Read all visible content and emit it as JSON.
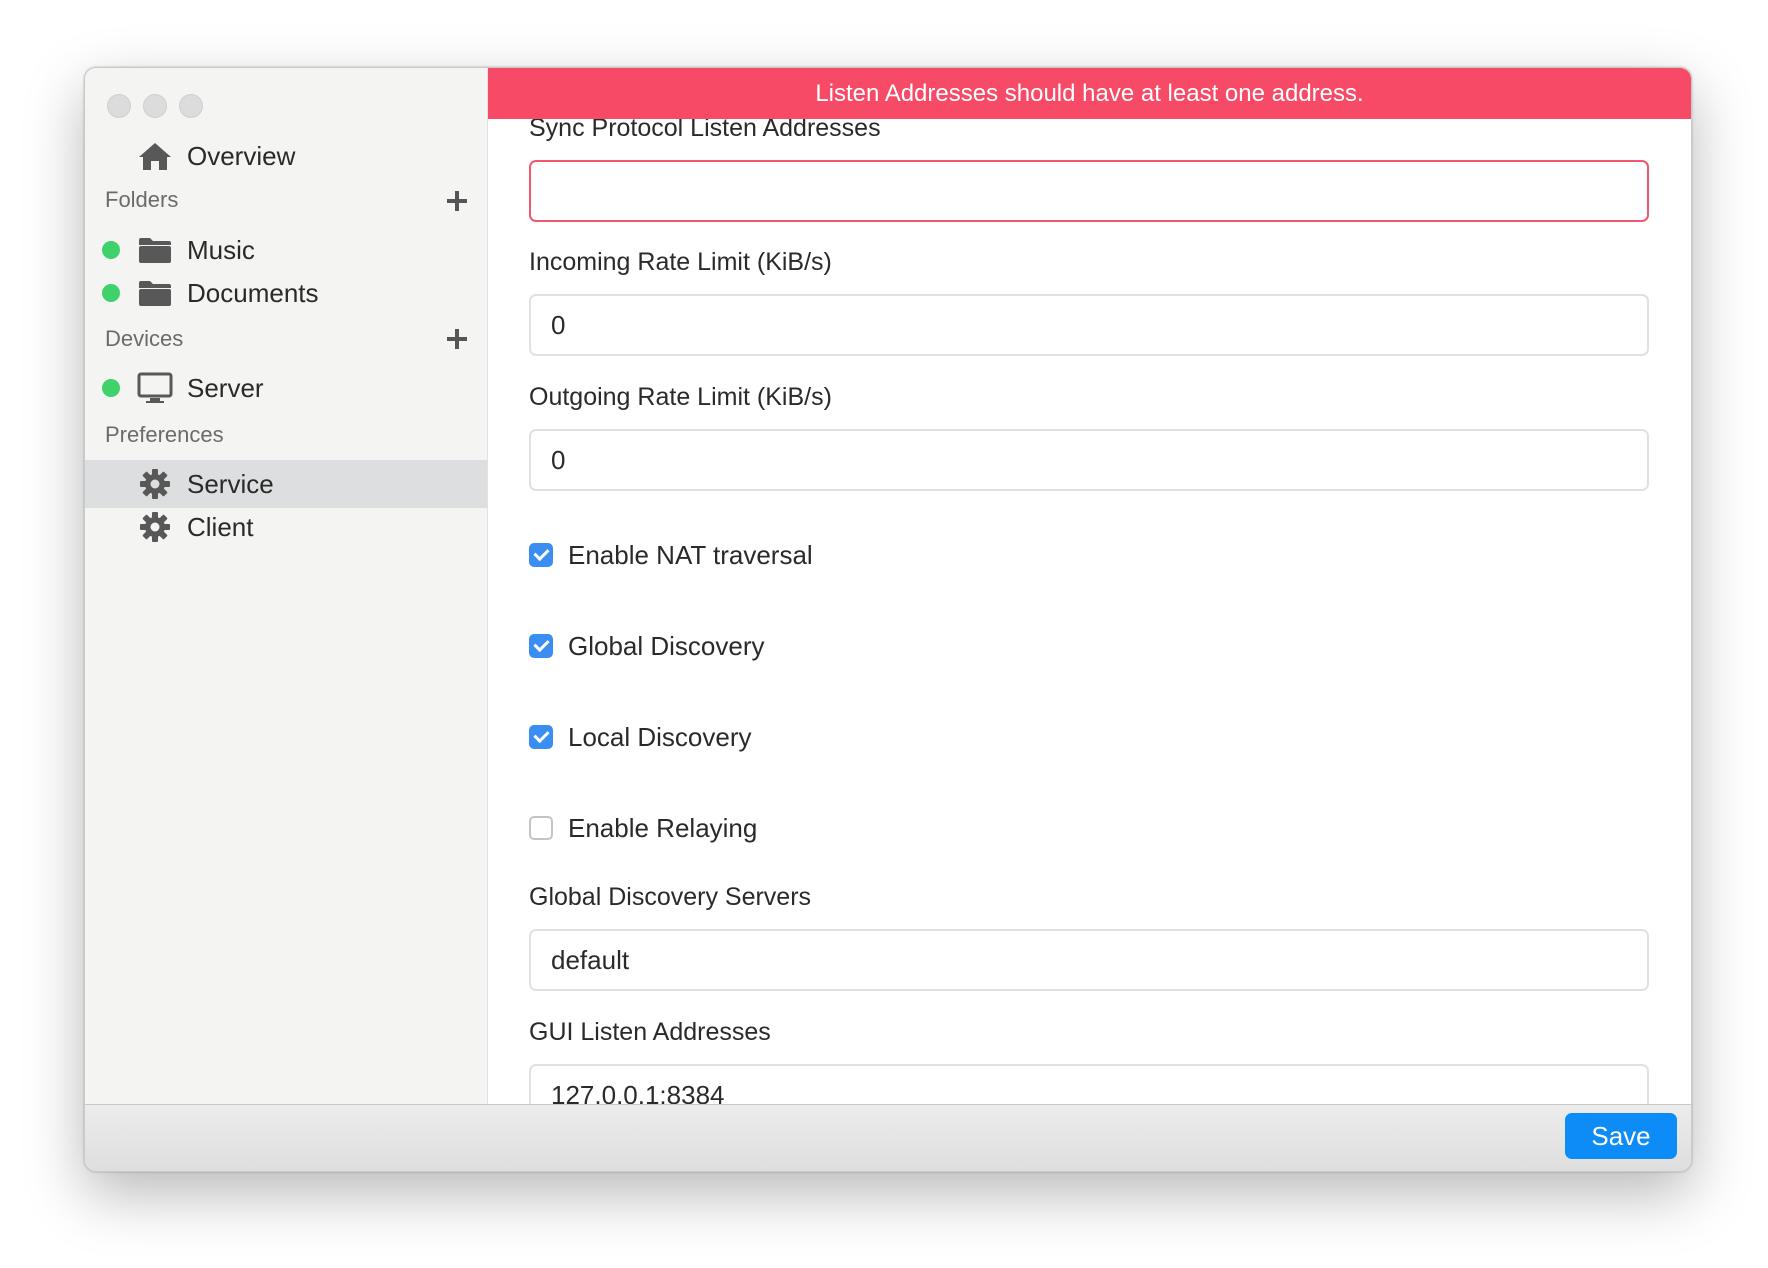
{
  "error_banner": "Listen Addresses should have at least one address.",
  "sidebar": {
    "overview": "Overview",
    "folders_header": "Folders",
    "folders": [
      "Music",
      "Documents"
    ],
    "devices_header": "Devices",
    "devices": [
      "Server"
    ],
    "preferences_header": "Preferences",
    "preferences": [
      "Service",
      "Client"
    ],
    "active": "Service",
    "status_color": "#3fd16a"
  },
  "form": {
    "sync_listen_label": "Sync Protocol Listen Addresses",
    "sync_listen_value": "",
    "incoming_label": "Incoming Rate Limit (KiB/s)",
    "incoming_value": "0",
    "outgoing_label": "Outgoing Rate Limit (KiB/s)",
    "outgoing_value": "0",
    "nat_label": "Enable NAT traversal",
    "nat_checked": true,
    "global_discovery_label": "Global Discovery",
    "global_discovery_checked": true,
    "local_discovery_label": "Local Discovery",
    "local_discovery_checked": true,
    "relaying_label": "Enable Relaying",
    "relaying_checked": false,
    "discovery_servers_label": "Global Discovery Servers",
    "discovery_servers_value": "default",
    "gui_listen_label": "GUI Listen Addresses",
    "gui_listen_value": "127.0.0.1:8384"
  },
  "footer": {
    "save_label": "Save"
  },
  "colors": {
    "accent": "#0d8bf7",
    "error": "#f74a66",
    "checkbox": "#3a8ef1"
  }
}
